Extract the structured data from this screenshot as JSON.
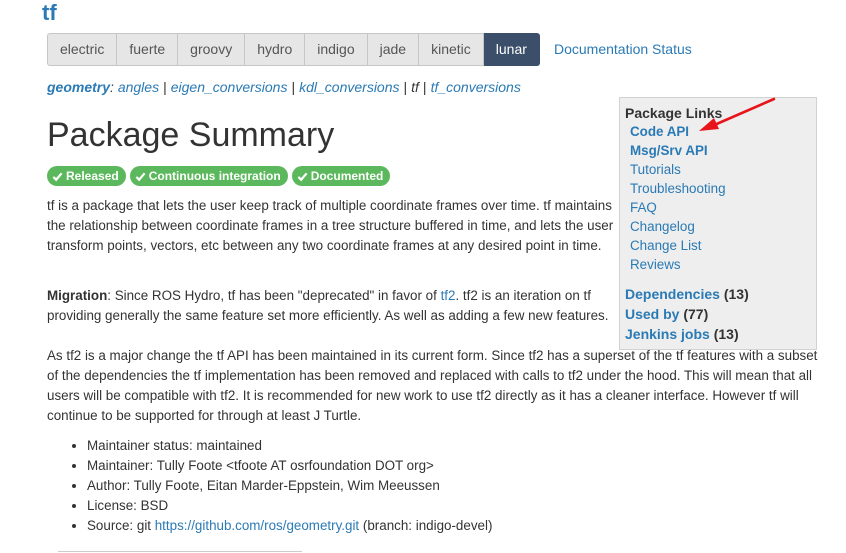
{
  "package_title": "tf",
  "distros": [
    "electric",
    "fuerte",
    "groovy",
    "hydro",
    "indigo",
    "jade",
    "kinetic",
    "lunar"
  ],
  "active_distro": "lunar",
  "documentation_status": "Documentation Status",
  "breadcrumb": {
    "root": "geometry",
    "colon": ":",
    "items": [
      "angles",
      "eigen_conversions",
      "kdl_conversions",
      "tf",
      "tf_conversions"
    ]
  },
  "heading": "Package Summary",
  "badges": [
    "Released",
    "Continuous integration",
    "Documented"
  ],
  "description": "tf is a package that lets the user keep track of multiple coordinate frames over time. tf maintains the relationship between coordinate frames in a tree structure buffered in time, and lets the user transform points, vectors, etc between any two coordinate frames at any desired point in time.",
  "migration": {
    "label": "Migration",
    "text_before": ": Since ROS Hydro, tf has been \"deprecated\" in favor of ",
    "link": "tf2",
    "text_after": ". tf2 is an iteration on tf providing generally the same feature set more efficiently. As well as adding a few new features.",
    "paragraph2": "As tf2 is a major change the tf API has been maintained in its current form. Since tf2 has a superset of the tf features with a subset of the dependencies the tf implementation has been removed and replaced with calls to tf2 under the hood. This will mean that all users will be compatible with tf2. It is recommended for new work to use tf2 directly as it has a cleaner interface. However tf will continue to be supported for through at least J Turtle."
  },
  "info": {
    "maintainer_status": "Maintainer status: maintained",
    "maintainer": "Maintainer: Tully Foote <tfoote AT osrfoundation DOT org>",
    "author": "Author: Tully Foote, Eitan Marder-Eppstein, Wim Meeussen",
    "license": "License: BSD",
    "source_prefix": "Source: git ",
    "source_link": "https://github.com/ros/geometry.git",
    "source_suffix": " (branch: indigo-devel)"
  },
  "sidebar": {
    "title": "Package Links",
    "links": [
      "Code API",
      "Msg/Srv API",
      "Tutorials",
      "Troubleshooting",
      "FAQ",
      "Changelog",
      "Change List",
      "Reviews"
    ],
    "dependencies": {
      "label": "Dependencies",
      "count": "(13)"
    },
    "used_by": {
      "label": "Used by",
      "count": "(77)"
    },
    "jenkins": {
      "label": "Jenkins jobs",
      "count": "(13)"
    }
  },
  "colors": {
    "link": "#2a7ab5",
    "active_tab": "#3b4e6a",
    "badge": "#5cb85c",
    "annotation_arrow": "#e8141b"
  }
}
